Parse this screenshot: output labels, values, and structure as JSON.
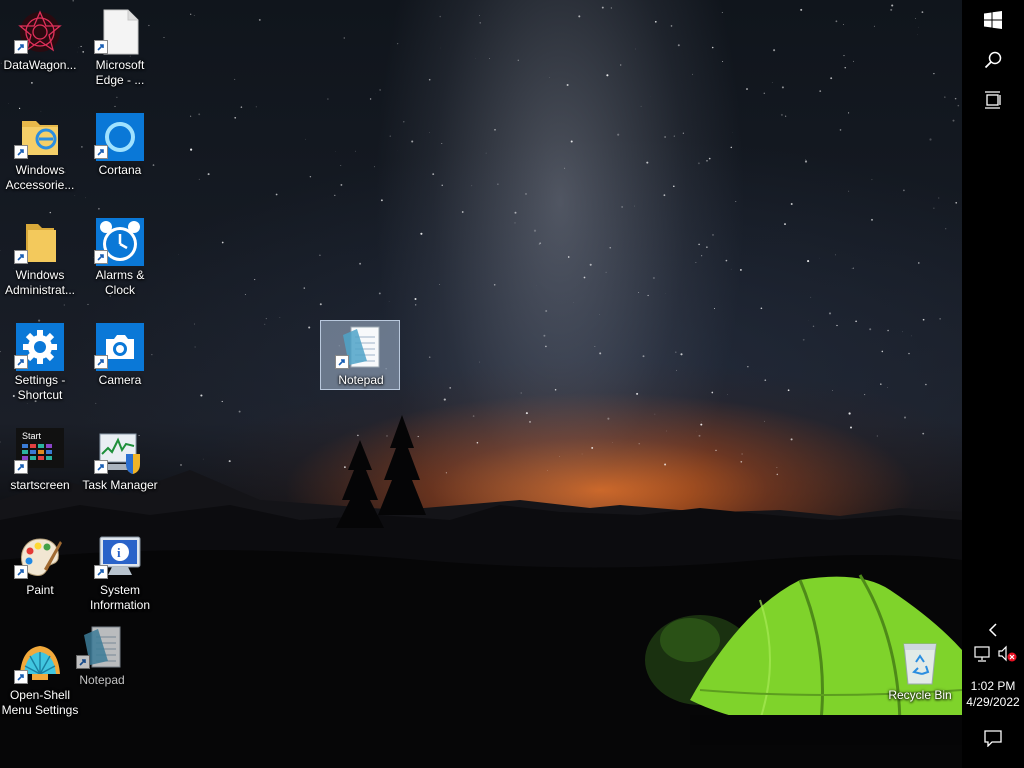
{
  "desktop": {
    "icons": [
      {
        "label": "DataWagon...",
        "icon": "datawagon-icon"
      },
      {
        "label": "Microsoft Edge - ...",
        "icon": "edge-document-icon"
      },
      {
        "label": "Windows Accessorie...",
        "icon": "folder-ie-icon"
      },
      {
        "label": "Cortana",
        "icon": "cortana-icon"
      },
      {
        "label": "Windows Administrat...",
        "icon": "folder-icon"
      },
      {
        "label": "Alarms & Clock",
        "icon": "alarm-clock-icon"
      },
      {
        "label": "Settings - Shortcut",
        "icon": "gear-icon"
      },
      {
        "label": "Camera",
        "icon": "camera-icon"
      },
      {
        "label": "startscreen",
        "icon": "startscreen-icon",
        "badge": "Start"
      },
      {
        "label": "Task Manager",
        "icon": "task-manager-icon"
      },
      {
        "label": "Paint",
        "icon": "paint-palette-icon"
      },
      {
        "label": "System Information",
        "icon": "system-info-icon"
      },
      {
        "label": "Open-Shell Menu Settings",
        "icon": "shell-icon"
      },
      {
        "label": "Notepad",
        "icon": "notepad-icon"
      },
      {
        "label": "Notepad",
        "icon": "notepad-icon",
        "selected": true
      },
      {
        "label": "Recycle Bin",
        "icon": "recycle-bin-icon"
      }
    ]
  },
  "taskbar": {
    "buttons": [
      "start-icon",
      "search-icon",
      "task-view-icon",
      "chevron-left-icon",
      "network-icon",
      "volume-muted-icon",
      "action-center-icon"
    ],
    "time": "1:02 PM",
    "date": "4/29/2022"
  },
  "colors": {
    "taskbar": "#000000",
    "selection": "#aabed7",
    "tent": "#7fd32b",
    "horizon_glow": "#eb6e1e"
  }
}
